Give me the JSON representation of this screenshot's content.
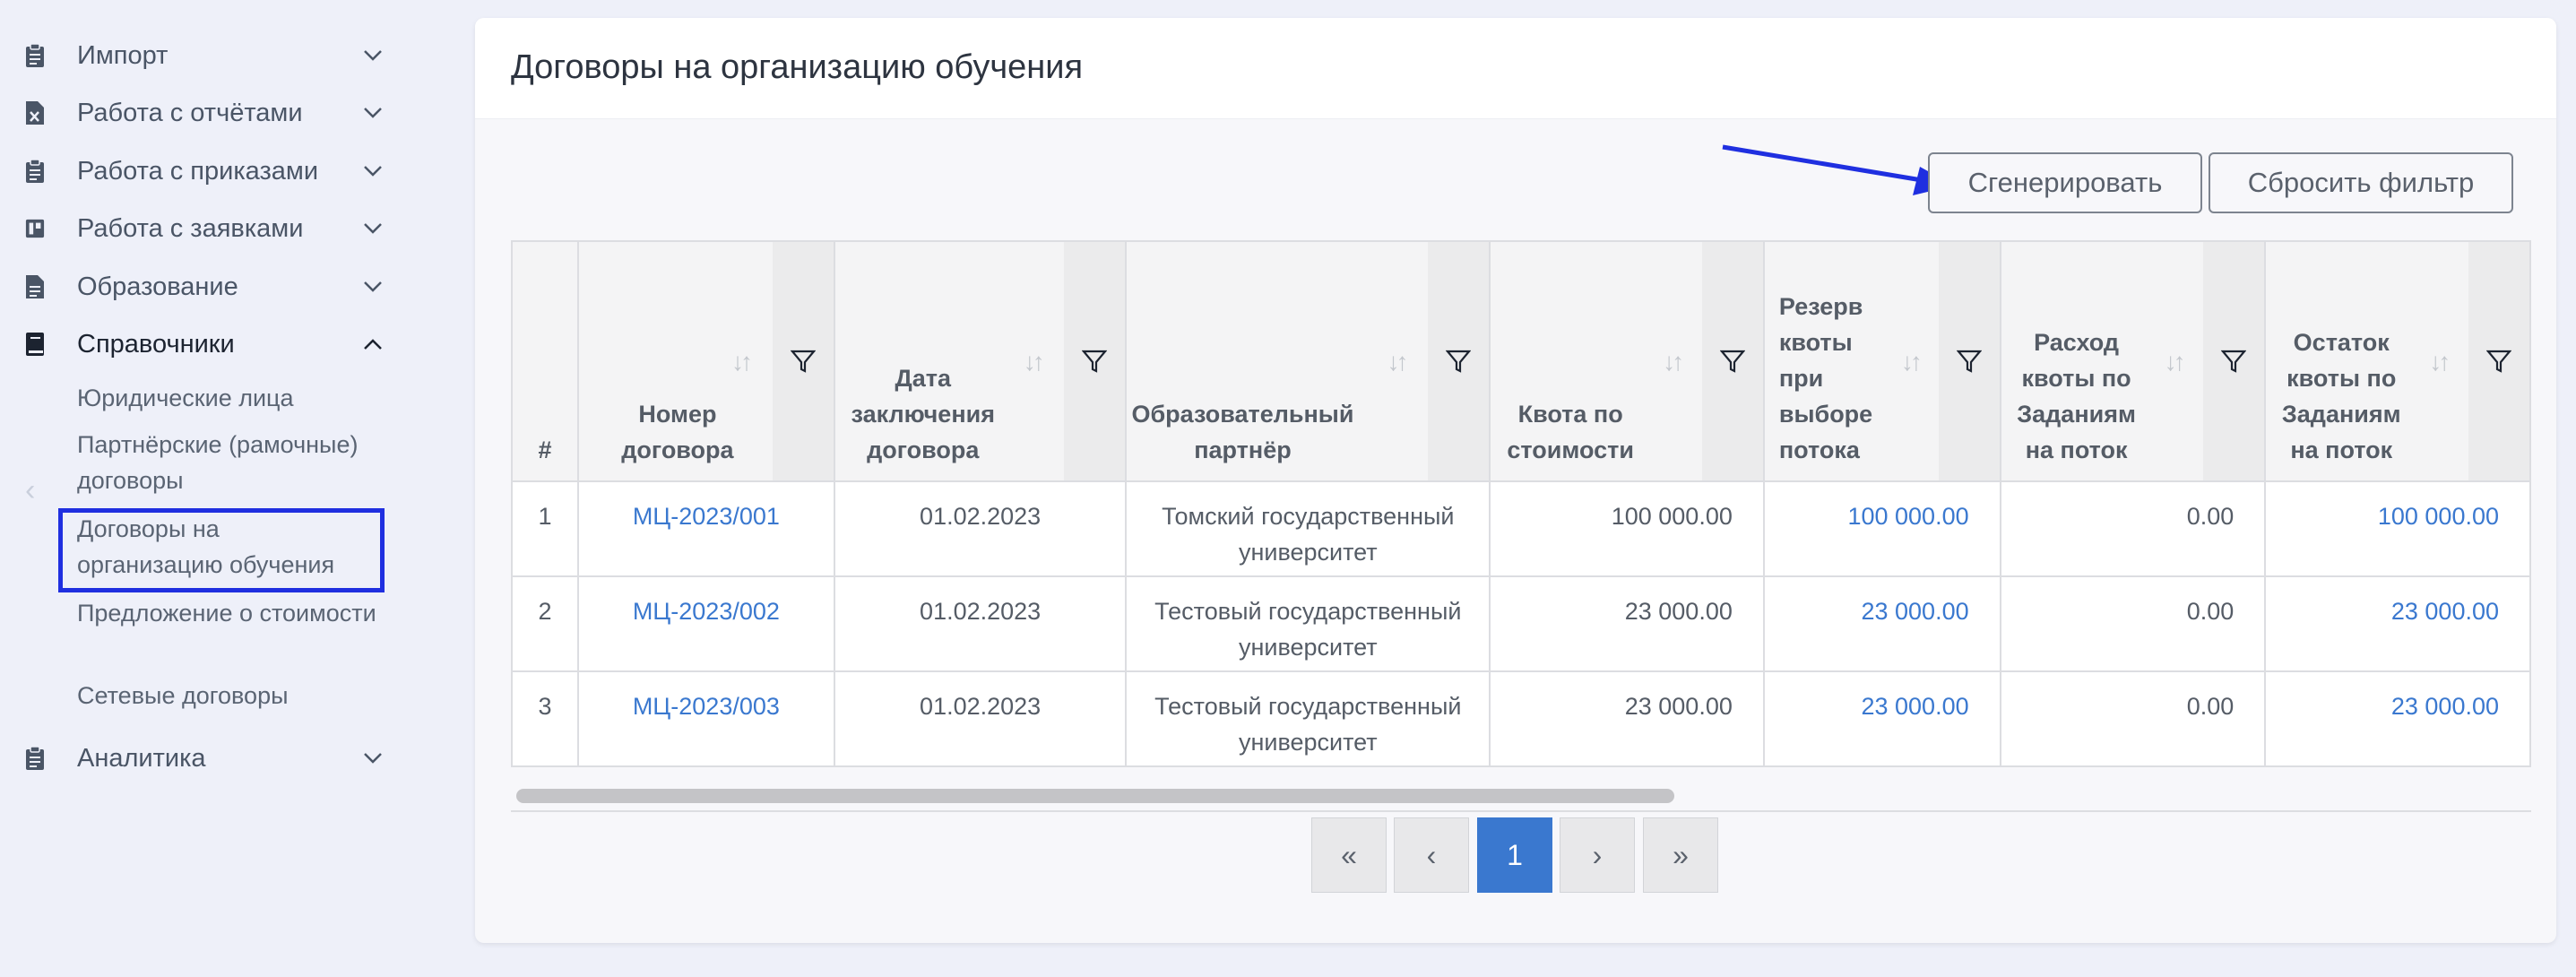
{
  "sidebar": {
    "items": [
      {
        "label": "Импорт",
        "icon": "clipboard-icon"
      },
      {
        "label": "Работа с отчётами",
        "icon": "excel-file-icon"
      },
      {
        "label": "Работа с приказами",
        "icon": "clipboard-icon"
      },
      {
        "label": "Работа с заявками",
        "icon": "board-icon"
      },
      {
        "label": "Образование",
        "icon": "document-icon"
      },
      {
        "label": "Справочники",
        "icon": "book-icon"
      },
      {
        "label": "Аналитика",
        "icon": "clipboard-icon"
      }
    ],
    "subitems": [
      {
        "label": "Юридические лица"
      },
      {
        "label": "Партнёрские (рамочные) договоры"
      },
      {
        "label": "Договоры на организацию обучения"
      },
      {
        "label": "Предложение о стоимости"
      },
      {
        "label": "Сетевые договоры"
      }
    ],
    "prev_arrow": "‹",
    "next_arrow": "›"
  },
  "page": {
    "title": "Договоры на организацию обучения",
    "generate_label": "Сгенерировать",
    "reset_filter_label": "Сбросить фильтр"
  },
  "table": {
    "headers": [
      "#",
      "Номер договора",
      "Дата заключения договора",
      "Образовательный партнёр",
      "Квота по стоимости",
      "Резерв квоты при выборе потока",
      "Расход квоты по Заданиям на поток",
      "Остаток квоты по Заданиям на поток"
    ],
    "rows": [
      {
        "n": "1",
        "number": "МЦ-2023/001",
        "date": "01.02.2023",
        "partner": "Томский государственный университет",
        "quota": "100 000.00",
        "reserve": "100 000.00",
        "spent": "0.00",
        "rest": "100 000.00"
      },
      {
        "n": "2",
        "number": "МЦ-2023/002",
        "date": "01.02.2023",
        "partner": "Тестовый государственный университет",
        "quota": "23 000.00",
        "reserve": "23 000.00",
        "spent": "0.00",
        "rest": "23 000.00"
      },
      {
        "n": "3",
        "number": "МЦ-2023/003",
        "date": "01.02.2023",
        "partner": "Тестовый государственный университет",
        "quota": "23 000.00",
        "reserve": "23 000.00",
        "spent": "0.00",
        "rest": "23 000.00"
      }
    ]
  },
  "pagination": {
    "first": "«",
    "prev": "‹",
    "current": "1",
    "next": "›",
    "last": "»"
  },
  "colors": {
    "accent": "#3a78cf",
    "highlight_box": "#1f2fe0",
    "arrow": "#1f2fe0"
  }
}
